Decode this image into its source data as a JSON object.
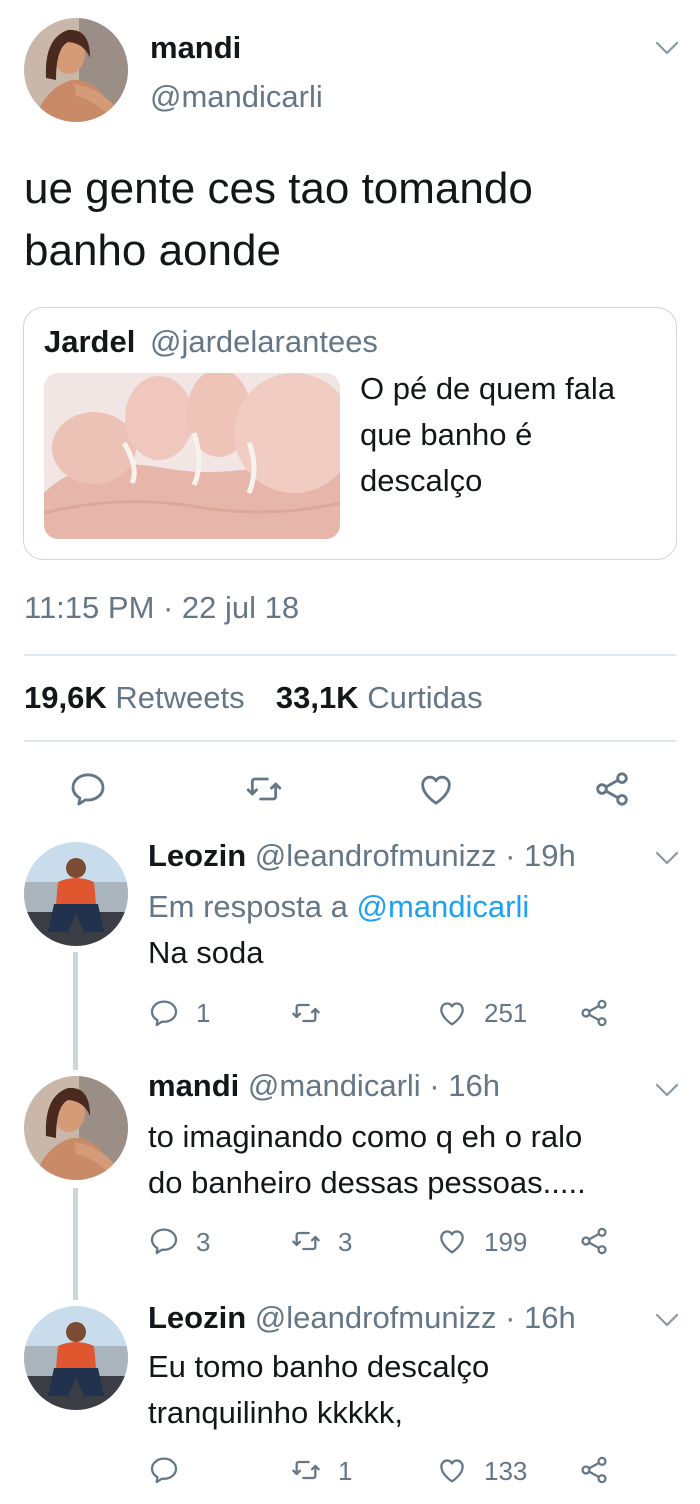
{
  "main_tweet": {
    "name": "mandi",
    "handle": "@mandicarli",
    "text_line1": "ue gente ces tao tomando",
    "text_line2": "banho aonde",
    "quote": {
      "name": "Jardel",
      "handle": "@jardelarantees",
      "text_line1": "O pé de quem fala",
      "text_line2": "que banho é",
      "text_line3": "descalço"
    },
    "timestamp": "11:15 PM · 22 jul 18",
    "retweets_count": "19,6K",
    "retweets_label": "Retweets",
    "likes_count": "33,1K",
    "likes_label": "Curtidas"
  },
  "replies": [
    {
      "name": "Leozin",
      "handle_time": "@leandrofmunizz · 19h",
      "reply_to_prefix": "Em resposta a ",
      "reply_to_handle": "@mandicarli",
      "text_line1": "Na soda",
      "replies": "1",
      "retweets": "",
      "likes": "251"
    },
    {
      "name": "mandi",
      "handle_time": "@mandicarli · 16h",
      "text_line1": "to imaginando como q eh o ralo",
      "text_line2": "do banheiro dessas pessoas.....",
      "replies": "3",
      "retweets": "3",
      "likes": "199"
    },
    {
      "name": "Leozin",
      "handle_time": "@leandrofmunizz · 16h",
      "text_line1": "Eu tomo banho descalço",
      "text_line2": "tranquilinho kkkkk,",
      "replies": "",
      "retweets": "1",
      "likes": "133"
    }
  ],
  "colors": {
    "accent": "#1da1f2",
    "muted": "#657786",
    "text": "#14171a",
    "divider": "#e1e8ed"
  },
  "icons": [
    "chevron-down-icon",
    "reply-icon",
    "retweet-icon",
    "like-icon",
    "share-icon"
  ]
}
